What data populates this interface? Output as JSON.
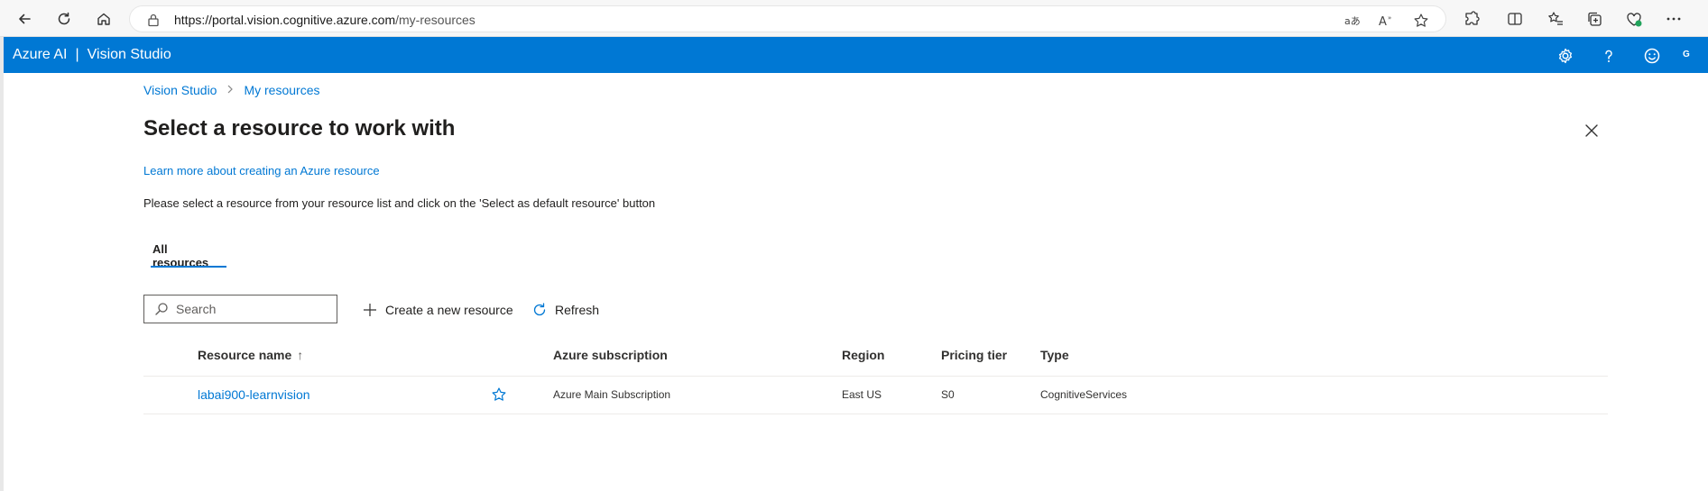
{
  "browser": {
    "url_base": "https://portal.vision.cognitive.azure.com",
    "url_path": "/my-resources"
  },
  "app": {
    "brand": "Azure AI",
    "separator": "|",
    "name": "Vision Studio",
    "avatar_initial": "G"
  },
  "breadcrumb": {
    "items": [
      "Vision Studio",
      "My resources"
    ]
  },
  "page": {
    "title": "Select a resource to work with",
    "learn_link": "Learn more about creating an Azure resource",
    "instructions": "Please select a resource from your resource list and click on the 'Select as default resource' button"
  },
  "tabs": [
    {
      "label": "All resources",
      "selected": true
    }
  ],
  "toolbar": {
    "search_placeholder": "Search",
    "create_label": "Create a new resource",
    "refresh_label": "Refresh"
  },
  "table": {
    "headers": {
      "name": "Resource name",
      "sort_arrow": "↑",
      "subscription": "Azure subscription",
      "region": "Region",
      "tier": "Pricing tier",
      "type": "Type"
    },
    "rows": [
      {
        "name": "labai900-learnvision",
        "subscription": "Azure Main Subscription",
        "region": "East US",
        "tier": "S0",
        "type": "CognitiveServices"
      }
    ]
  },
  "colors": {
    "accent": "#0078d4",
    "header_bg": "#0078d4"
  },
  "icons": [
    "back-icon",
    "refresh-icon",
    "home-icon",
    "lock-icon",
    "translate-icon",
    "read-aloud-icon",
    "favorite-icon",
    "extensions-icon",
    "split-screen-icon",
    "favorites-list-icon",
    "collections-icon",
    "browser-essentials-icon",
    "more-icon",
    "settings-icon",
    "help-icon",
    "feedback-icon",
    "close-icon",
    "search-icon",
    "plus-icon",
    "refresh-small-icon",
    "star-icon"
  ]
}
